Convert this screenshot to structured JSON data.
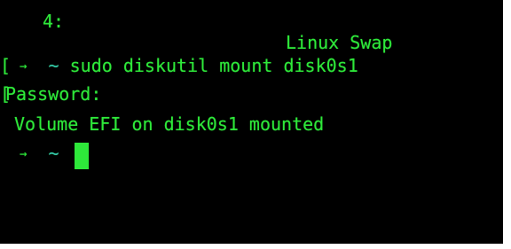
{
  "terminal": {
    "partial_row": {
      "number": "4:",
      "type": "Linux Swap"
    },
    "command_line": {
      "bracket": "[",
      "arrow": "→",
      "tilde": "~",
      "command": "sudo diskutil mount disk0s1"
    },
    "password_line": {
      "bracket": "[",
      "text": "Password:"
    },
    "output_line": {
      "text": "Volume EFI on disk0s1 mounted"
    },
    "prompt_line": {
      "arrow": "→",
      "tilde": "~"
    },
    "colors": {
      "background": "#000000",
      "text": "#2ee83a",
      "tilde": "#34c6b0",
      "cursor": "#2ee83a"
    }
  }
}
